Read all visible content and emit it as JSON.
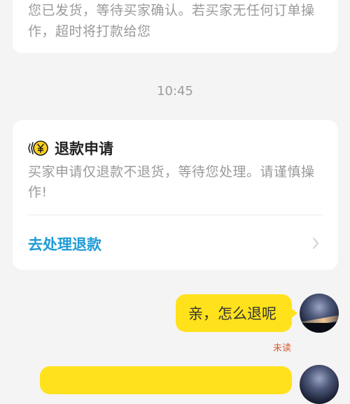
{
  "top_message": {
    "text": "您已发货，等待买家确认。若买家无任何订单操作，超时将打款给您"
  },
  "timestamp": "10:45",
  "refund_card": {
    "title": "退款申请",
    "description": "买家申请仅退款不退货，等待您处理。请谨慎操作!",
    "action_label": "去处理退款",
    "icon": "refund-yen-icon",
    "accent_color": "#1e9bd7"
  },
  "messages": [
    {
      "text": "亲，怎么退呢",
      "status": "未读"
    }
  ],
  "colors": {
    "bubble": "#ffe21c",
    "background": "#f4f4f4",
    "unread": "#d35a2e"
  }
}
